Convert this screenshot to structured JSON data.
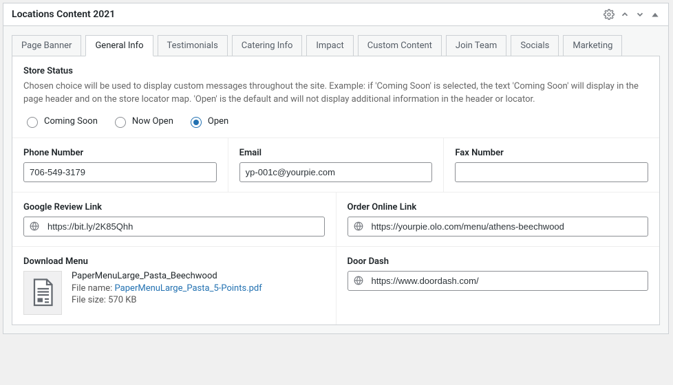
{
  "panel": {
    "title": "Locations Content 2021"
  },
  "tabs": [
    {
      "label": "Page Banner"
    },
    {
      "label": "General Info"
    },
    {
      "label": "Testimonials"
    },
    {
      "label": "Catering Info"
    },
    {
      "label": "Impact"
    },
    {
      "label": "Custom Content"
    },
    {
      "label": "Join Team"
    },
    {
      "label": "Socials"
    },
    {
      "label": "Marketing"
    }
  ],
  "active_tab": "General Info",
  "store_status": {
    "label": "Store Status",
    "help": "Chosen choice will be used to display custom messages throughout the site. Example: if 'Coming Soon' is selected, the text 'Coming Soon' will display in the page header and on the store locator map. 'Open' is the default and will not display additional information in the header or locator.",
    "options": [
      "Coming Soon",
      "Now Open",
      "Open"
    ],
    "selected": "Open"
  },
  "phone": {
    "label": "Phone Number",
    "value": "706-549-3179"
  },
  "email": {
    "label": "Email",
    "value": "yp-001c@yourpie.com"
  },
  "fax": {
    "label": "Fax Number",
    "value": ""
  },
  "google_review": {
    "label": "Google Review Link",
    "value": "https://bit.ly/2K85Qhh"
  },
  "order_online": {
    "label": "Order Online Link",
    "value": "https://yourpie.olo.com/menu/athens-beechwood"
  },
  "download_menu": {
    "label": "Download Menu",
    "title": "PaperMenuLarge_Pasta_Beechwood",
    "file_name_label": "File name: ",
    "file_name": "PaperMenuLarge_Pasta_5-Points.pdf",
    "file_size_label": "File size: ",
    "file_size": "570 KB"
  },
  "doordash": {
    "label": "Door Dash",
    "value": "https://www.doordash.com/"
  }
}
